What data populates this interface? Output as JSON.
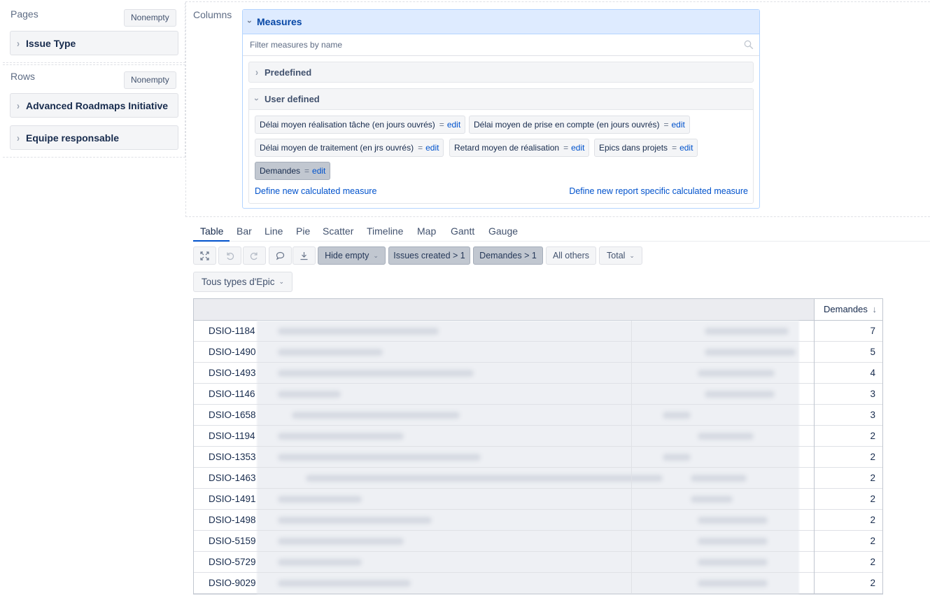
{
  "pages": {
    "title": "Pages",
    "nonempty_label": "Nonempty",
    "dimension": "Issue Type"
  },
  "rows": {
    "title": "Rows",
    "nonempty_label": "Nonempty",
    "dimensions": [
      "Advanced Roadmaps Initiative",
      "Equipe responsable"
    ]
  },
  "columns": {
    "title": "Columns"
  },
  "measures": {
    "title": "Measures",
    "filter_placeholder": "Filter measures by name",
    "predefined_label": "Predefined",
    "user_defined_label": "User defined",
    "eq": "=",
    "edit_label": "edit",
    "items": [
      "Délai moyen réalisation tâche (en jours ouvrés)",
      "Délai moyen de prise en compte (en jours ouvrés)",
      "Délai moyen de traitement (en jrs ouvrés)",
      "Retard moyen de réalisation",
      "Epics dans projets",
      "Demandes"
    ],
    "define_new": "Define new calculated measure",
    "define_report_specific": "Define new report specific calculated measure"
  },
  "tabs": [
    "Table",
    "Bar",
    "Line",
    "Pie",
    "Scatter",
    "Timeline",
    "Map",
    "Gantt",
    "Gauge"
  ],
  "toolbar": {
    "hide_empty": "Hide empty",
    "issues_created": "Issues created > 1",
    "demandes_filter": "Demandes > 1",
    "all_others": "All others",
    "total": "Total"
  },
  "epic_filter": "Tous types d'Epic",
  "table": {
    "measure_header": "Demandes",
    "sort_arrow": "↓",
    "rows": [
      {
        "key": "DSIO-1184",
        "value": "7"
      },
      {
        "key": "DSIO-1490",
        "value": "5"
      },
      {
        "key": "DSIO-1493",
        "value": "4"
      },
      {
        "key": "DSIO-1146",
        "value": "3"
      },
      {
        "key": "DSIO-1658",
        "value": "3"
      },
      {
        "key": "DSIO-1194",
        "value": "2"
      },
      {
        "key": "DSIO-1353",
        "value": "2"
      },
      {
        "key": "DSIO-1463",
        "value": "2"
      },
      {
        "key": "DSIO-1491",
        "value": "2"
      },
      {
        "key": "DSIO-1498",
        "value": "2"
      },
      {
        "key": "DSIO-5159",
        "value": "2"
      },
      {
        "key": "DSIO-5729",
        "value": "2"
      },
      {
        "key": "DSIO-9029",
        "value": "2"
      }
    ]
  }
}
